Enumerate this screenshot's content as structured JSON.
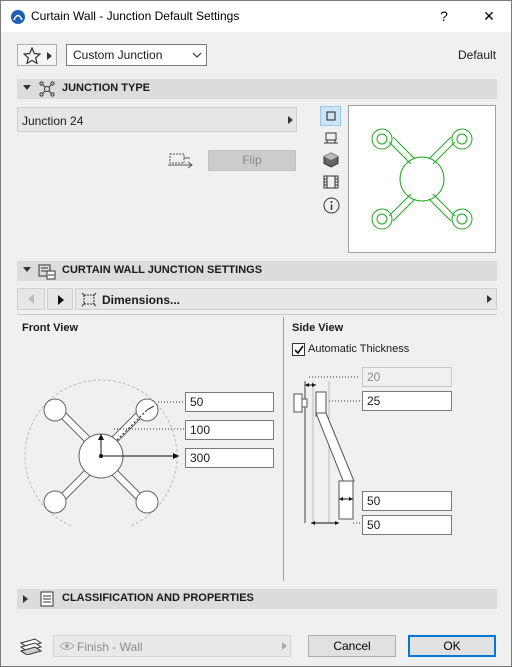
{
  "window": {
    "title": "Curtain Wall - Junction Default Settings",
    "help": "?",
    "close": "✕"
  },
  "top": {
    "junction_select": "Custom Junction",
    "default_label": "Default"
  },
  "junction_type": {
    "header": "JUNCTION TYPE",
    "selected": "Junction 24",
    "flip_label": "Flip"
  },
  "junction_settings": {
    "header": "CURTAIN WALL JUNCTION SETTINGS",
    "panel_label": "Dimensions...",
    "front_view": {
      "title": "Front View",
      "field1": "50",
      "field2": "100",
      "field3": "300"
    },
    "side_view": {
      "title": "Side View",
      "auto_thickness_label": "Automatic Thickness",
      "auto_thickness_checked": true,
      "field_thickness": "20",
      "field_depth": "25",
      "field_bottom1": "50",
      "field_bottom2": "50"
    }
  },
  "classification": {
    "header": "CLASSIFICATION AND PROPERTIES"
  },
  "footer": {
    "layer": "Finish - Wall",
    "cancel": "Cancel",
    "ok": "OK"
  },
  "colors": {
    "preview_green": "#1fa31f",
    "ok_border": "#0078d7"
  }
}
